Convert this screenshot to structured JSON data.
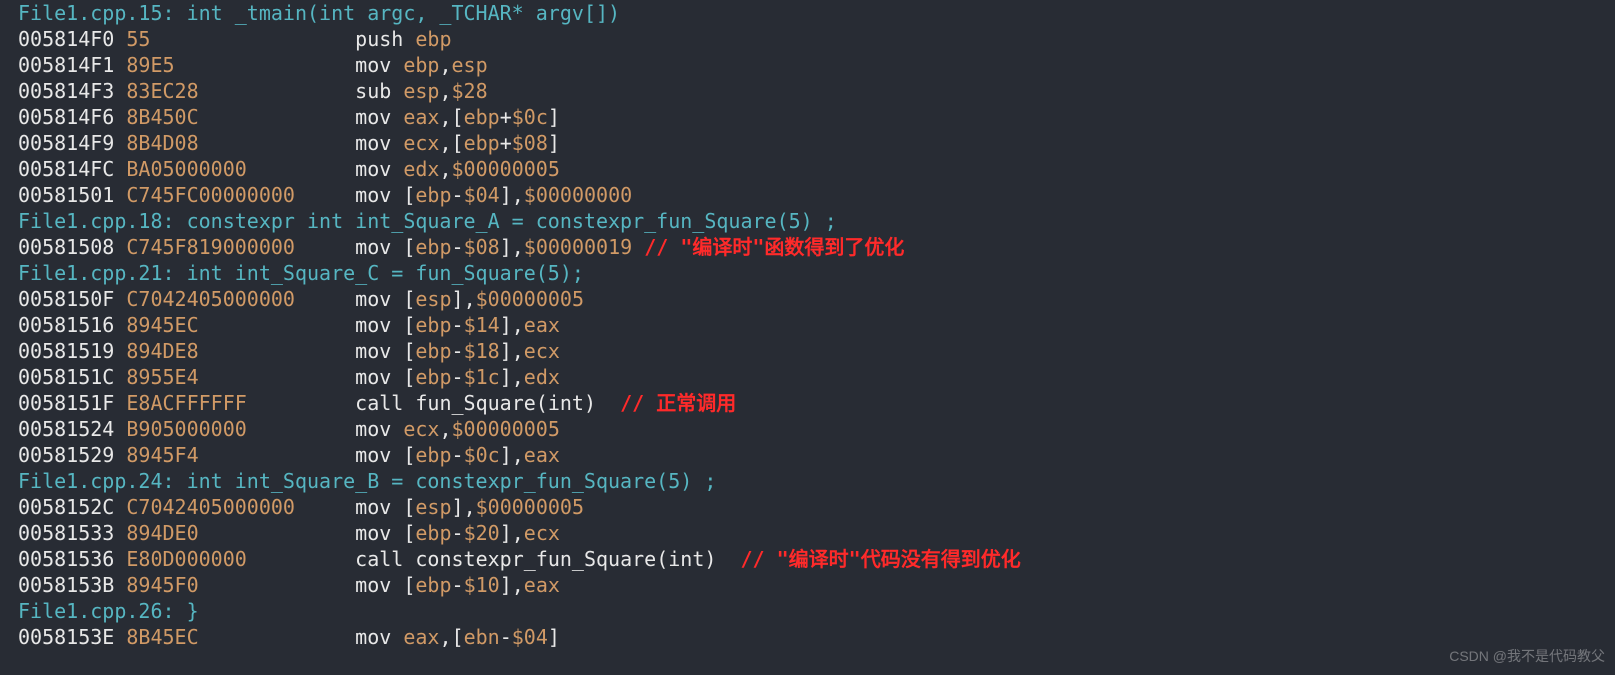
{
  "watermark": "CSDN @我不是代码教父",
  "lines": [
    {
      "kind": "src",
      "text": "File1.cpp.15: int _tmain(int argc, _TCHAR* argv[])"
    },
    {
      "kind": "ins",
      "addr": "005814F0",
      "hex": "55",
      "hex_pad": "              ",
      "mn": "push ",
      "regs": [
        "ebp"
      ]
    },
    {
      "kind": "ins",
      "addr": "005814F1",
      "hex": "89E5",
      "hex_pad": "            ",
      "mn": "mov ",
      "regs_seq": [
        {
          "t": "reg",
          "v": "ebp"
        },
        {
          "t": "op",
          "v": ","
        },
        {
          "t": "reg",
          "v": "esp"
        }
      ]
    },
    {
      "kind": "ins",
      "addr": "005814F3",
      "hex": "83EC28",
      "hex_pad": "          ",
      "mn": "sub ",
      "regs_seq": [
        {
          "t": "reg",
          "v": "esp"
        },
        {
          "t": "op",
          "v": ","
        },
        {
          "t": "num",
          "v": "$28"
        }
      ]
    },
    {
      "kind": "ins",
      "addr": "005814F6",
      "hex": "8B450C",
      "hex_pad": "          ",
      "mn": "mov ",
      "regs_seq": [
        {
          "t": "reg",
          "v": "eax"
        },
        {
          "t": "op",
          "v": ","
        },
        {
          "t": "br",
          "v": "["
        },
        {
          "t": "reg",
          "v": "ebp"
        },
        {
          "t": "op",
          "v": "+"
        },
        {
          "t": "num",
          "v": "$0c"
        },
        {
          "t": "br",
          "v": "]"
        }
      ]
    },
    {
      "kind": "ins",
      "addr": "005814F9",
      "hex": "8B4D08",
      "hex_pad": "          ",
      "mn": "mov ",
      "regs_seq": [
        {
          "t": "reg",
          "v": "ecx"
        },
        {
          "t": "op",
          "v": ","
        },
        {
          "t": "br",
          "v": "["
        },
        {
          "t": "reg",
          "v": "ebp"
        },
        {
          "t": "op",
          "v": "+"
        },
        {
          "t": "num",
          "v": "$08"
        },
        {
          "t": "br",
          "v": "]"
        }
      ]
    },
    {
      "kind": "ins",
      "addr": "005814FC",
      "hex": "BA05000000",
      "hex_pad": "      ",
      "mn": "mov ",
      "regs_seq": [
        {
          "t": "reg",
          "v": "edx"
        },
        {
          "t": "op",
          "v": ","
        },
        {
          "t": "num",
          "v": "$00000005"
        }
      ]
    },
    {
      "kind": "ins",
      "addr": "00581501",
      "hex": "C745FC00000000",
      "hex_pad": "  ",
      "mn": "mov ",
      "regs_seq": [
        {
          "t": "br",
          "v": "["
        },
        {
          "t": "reg",
          "v": "ebp"
        },
        {
          "t": "op",
          "v": "-"
        },
        {
          "t": "num",
          "v": "$04"
        },
        {
          "t": "br",
          "v": "]"
        },
        {
          "t": "op",
          "v": ","
        },
        {
          "t": "num",
          "v": "$00000000"
        }
      ]
    },
    {
      "kind": "src",
      "text": "File1.cpp.18: constexpr int int_Square_A = constexpr_fun_Square(5) ;"
    },
    {
      "kind": "ins",
      "addr": "00581508",
      "hex": "C745F819000000",
      "hex_pad": "  ",
      "mn": "mov ",
      "regs_seq": [
        {
          "t": "br",
          "v": "["
        },
        {
          "t": "reg",
          "v": "ebp"
        },
        {
          "t": "op",
          "v": "-"
        },
        {
          "t": "num",
          "v": "$08"
        },
        {
          "t": "br",
          "v": "]"
        },
        {
          "t": "op",
          "v": ","
        },
        {
          "t": "num",
          "v": "$00000019"
        }
      ],
      "comment": " // \"编译时\"函数得到了优化"
    },
    {
      "kind": "src",
      "text": "File1.cpp.21: int int_Square_C = fun_Square(5);"
    },
    {
      "kind": "ins",
      "addr": "0058150F",
      "hex": "C7042405000000",
      "hex_pad": "  ",
      "mn": "mov ",
      "regs_seq": [
        {
          "t": "br",
          "v": "["
        },
        {
          "t": "reg",
          "v": "esp"
        },
        {
          "t": "br",
          "v": "]"
        },
        {
          "t": "op",
          "v": ","
        },
        {
          "t": "num",
          "v": "$00000005"
        }
      ]
    },
    {
      "kind": "ins",
      "addr": "00581516",
      "hex": "8945EC",
      "hex_pad": "          ",
      "mn": "mov ",
      "regs_seq": [
        {
          "t": "br",
          "v": "["
        },
        {
          "t": "reg",
          "v": "ebp"
        },
        {
          "t": "op",
          "v": "-"
        },
        {
          "t": "num",
          "v": "$14"
        },
        {
          "t": "br",
          "v": "]"
        },
        {
          "t": "op",
          "v": ","
        },
        {
          "t": "reg",
          "v": "eax"
        }
      ]
    },
    {
      "kind": "ins",
      "addr": "00581519",
      "hex": "894DE8",
      "hex_pad": "          ",
      "mn": "mov ",
      "regs_seq": [
        {
          "t": "br",
          "v": "["
        },
        {
          "t": "reg",
          "v": "ebp"
        },
        {
          "t": "op",
          "v": "-"
        },
        {
          "t": "num",
          "v": "$18"
        },
        {
          "t": "br",
          "v": "]"
        },
        {
          "t": "op",
          "v": ","
        },
        {
          "t": "reg",
          "v": "ecx"
        }
      ]
    },
    {
      "kind": "ins",
      "addr": "0058151C",
      "hex": "8955E4",
      "hex_pad": "          ",
      "mn": "mov ",
      "regs_seq": [
        {
          "t": "br",
          "v": "["
        },
        {
          "t": "reg",
          "v": "ebp"
        },
        {
          "t": "op",
          "v": "-"
        },
        {
          "t": "num",
          "v": "$1c"
        },
        {
          "t": "br",
          "v": "]"
        },
        {
          "t": "op",
          "v": ","
        },
        {
          "t": "reg",
          "v": "edx"
        }
      ]
    },
    {
      "kind": "ins",
      "addr": "0058151F",
      "hex": "E8ACFFFFFF",
      "hex_pad": "      ",
      "mn": "call ",
      "plain": "fun_Square(int)  ",
      "comment": "// 正常调用"
    },
    {
      "kind": "ins",
      "addr": "00581524",
      "hex": "B905000000",
      "hex_pad": "      ",
      "mn": "mov ",
      "regs_seq": [
        {
          "t": "reg",
          "v": "ecx"
        },
        {
          "t": "op",
          "v": ","
        },
        {
          "t": "num",
          "v": "$00000005"
        }
      ]
    },
    {
      "kind": "ins",
      "addr": "00581529",
      "hex": "8945F4",
      "hex_pad": "          ",
      "mn": "mov ",
      "regs_seq": [
        {
          "t": "br",
          "v": "["
        },
        {
          "t": "reg",
          "v": "ebp"
        },
        {
          "t": "op",
          "v": "-"
        },
        {
          "t": "num",
          "v": "$0c"
        },
        {
          "t": "br",
          "v": "]"
        },
        {
          "t": "op",
          "v": ","
        },
        {
          "t": "reg",
          "v": "eax"
        }
      ]
    },
    {
      "kind": "src",
      "text": "File1.cpp.24: int int_Square_B = constexpr_fun_Square(5) ;"
    },
    {
      "kind": "ins",
      "addr": "0058152C",
      "hex": "C7042405000000",
      "hex_pad": "  ",
      "mn": "mov ",
      "regs_seq": [
        {
          "t": "br",
          "v": "["
        },
        {
          "t": "reg",
          "v": "esp"
        },
        {
          "t": "br",
          "v": "]"
        },
        {
          "t": "op",
          "v": ","
        },
        {
          "t": "num",
          "v": "$00000005"
        }
      ]
    },
    {
      "kind": "ins",
      "addr": "00581533",
      "hex": "894DE0",
      "hex_pad": "          ",
      "mn": "mov ",
      "regs_seq": [
        {
          "t": "br",
          "v": "["
        },
        {
          "t": "reg",
          "v": "ebp"
        },
        {
          "t": "op",
          "v": "-"
        },
        {
          "t": "num",
          "v": "$20"
        },
        {
          "t": "br",
          "v": "]"
        },
        {
          "t": "op",
          "v": ","
        },
        {
          "t": "reg",
          "v": "ecx"
        }
      ]
    },
    {
      "kind": "ins",
      "addr": "00581536",
      "hex": "E80D000000",
      "hex_pad": "      ",
      "mn": "call ",
      "plain": "constexpr_fun_Square(int)  ",
      "comment": "// \"编译时\"代码没有得到优化"
    },
    {
      "kind": "ins",
      "addr": "0058153B",
      "hex": "8945F0",
      "hex_pad": "          ",
      "mn": "mov ",
      "regs_seq": [
        {
          "t": "br",
          "v": "["
        },
        {
          "t": "reg",
          "v": "ebp"
        },
        {
          "t": "op",
          "v": "-"
        },
        {
          "t": "num",
          "v": "$10"
        },
        {
          "t": "br",
          "v": "]"
        },
        {
          "t": "op",
          "v": ","
        },
        {
          "t": "reg",
          "v": "eax"
        }
      ]
    },
    {
      "kind": "src",
      "text": "File1.cpp.26: }"
    },
    {
      "kind": "ins",
      "addr": "0058153E",
      "hex": "8B45EC",
      "hex_pad": "          ",
      "mn": "mov ",
      "regs_seq": [
        {
          "t": "reg",
          "v": "eax"
        },
        {
          "t": "op",
          "v": ","
        },
        {
          "t": "br",
          "v": "["
        },
        {
          "t": "reg",
          "v": "ebn"
        },
        {
          "t": "op",
          "v": "-"
        },
        {
          "t": "num",
          "v": "$04"
        },
        {
          "t": "br",
          "v": "]"
        }
      ]
    }
  ]
}
